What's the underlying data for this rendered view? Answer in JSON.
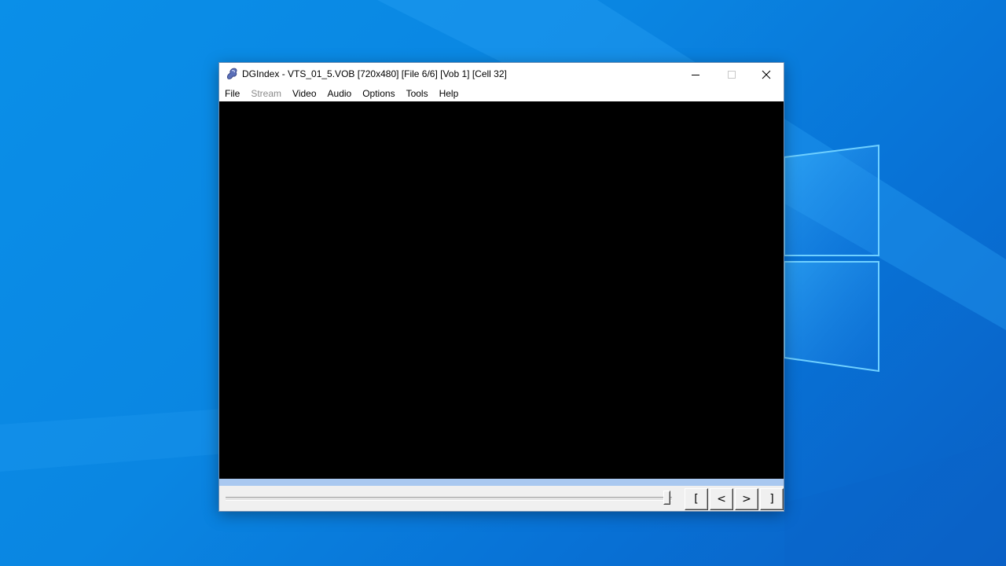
{
  "window": {
    "title": "DGIndex - VTS_01_5.VOB [720x480] [File 6/6] [Vob 1] [Cell 32]",
    "app_icon": "dgindex-icon",
    "caption_buttons": [
      "minimize-icon",
      "maximize-icon",
      "close-icon"
    ]
  },
  "menu": {
    "items": [
      {
        "label": "File",
        "enabled": true
      },
      {
        "label": "Stream",
        "enabled": false
      },
      {
        "label": "Video",
        "enabled": true
      },
      {
        "label": "Audio",
        "enabled": true
      },
      {
        "label": "Options",
        "enabled": true
      },
      {
        "label": "Tools",
        "enabled": true
      },
      {
        "label": "Help",
        "enabled": true
      }
    ]
  },
  "controls": {
    "position_fraction": 1.0,
    "buttons": {
      "mark_start": "[",
      "step_back": "<",
      "step_forward": ">",
      "mark_end": "]"
    }
  },
  "colors": {
    "desktop": "#0a86e2",
    "video": "#000000",
    "progress_strip": "#a9c8f0",
    "disabled_menu": "#8a8a8a"
  }
}
